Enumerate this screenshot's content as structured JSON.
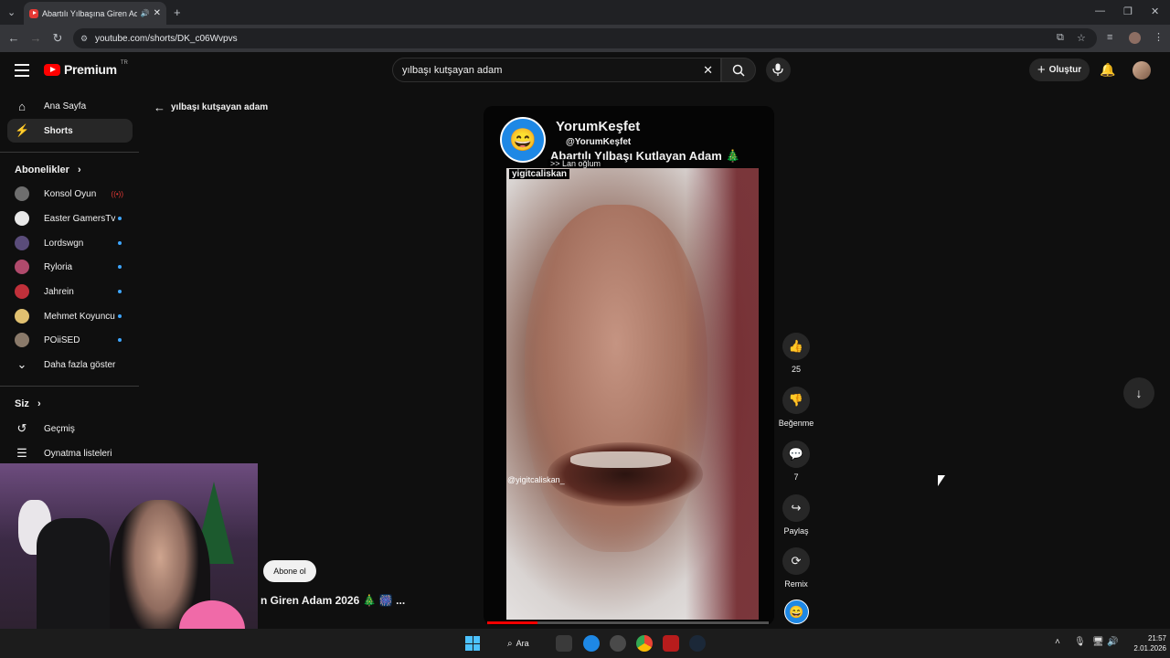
{
  "browser": {
    "tab_title": "Abartılı Yılbaşına Giren Ada",
    "url": "youtube.com/shorts/DK_c06Wvpvs"
  },
  "header": {
    "logo_text": "Premium",
    "logo_region": "TR",
    "search_value": "yılbaşı kutşayan adam",
    "create_label": "Oluştur"
  },
  "sidebar": {
    "main": [
      {
        "label": "Ana Sayfa",
        "icon": "home-icon"
      },
      {
        "label": "Shorts",
        "icon": "shorts-icon"
      }
    ],
    "subscriptions_title": "Abonelikler",
    "subscriptions": [
      {
        "label": "Konsol Oyun",
        "color": "#6e6e6e",
        "live": true
      },
      {
        "label": "Easter GamersTv",
        "color": "#e8e8e8",
        "live": false
      },
      {
        "label": "Lordswgn",
        "color": "#5a4c7a",
        "live": false
      },
      {
        "label": "Ryloria",
        "color": "#b04a6c",
        "live": false
      },
      {
        "label": "Jahrein",
        "color": "#c0303a",
        "live": false
      },
      {
        "label": "Mehmet Koyuncu",
        "color": "#e0c070",
        "live": false
      },
      {
        "label": "POiiSED",
        "color": "#8a7a6a",
        "live": false
      }
    ],
    "show_more": "Daha fazla göster",
    "you_title": "Siz",
    "you_items": [
      {
        "label": "Geçmiş",
        "icon": "history-icon"
      },
      {
        "label": "Oynatma listeleri",
        "icon": "playlists-icon"
      }
    ]
  },
  "main": {
    "back_query": "yılbaşı kutşayan adam",
    "channel_name": "YorumKeşfet",
    "channel_handle": "@YorumKeşfet",
    "video_title": "Abartılı Yılbaşı Kutlayan Adam 🎄",
    "caption_1": ">> Lan oğlum",
    "caption_2": "yigitcaliskan",
    "watermark": "@yigitcaliskan_",
    "progress": 0.18,
    "subscribe_label": "Abone ol",
    "under_title": "n Giren Adam 2026 🎄 🎆 ..."
  },
  "actions": {
    "likes": "25",
    "dislike_label": "Beğenme",
    "comments": "7",
    "share_label": "Paylaş",
    "remix_label": "Remix"
  },
  "taskbar": {
    "search_label": "Ara",
    "time": "21:57",
    "date": "2.01.2026"
  },
  "colors": {
    "background": "#0f0f0f",
    "accent": "#ff0000",
    "live_dot": "#3ea6ff"
  }
}
